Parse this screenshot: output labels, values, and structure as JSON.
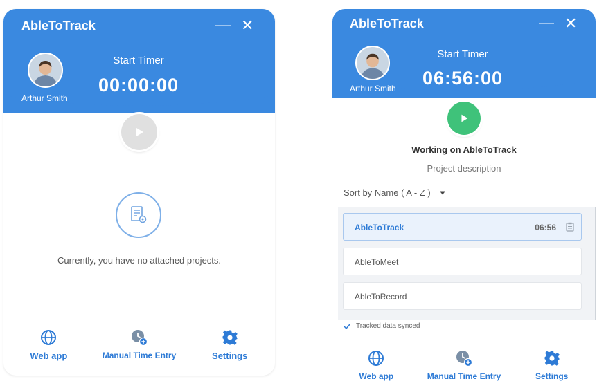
{
  "left": {
    "app_title": "AbleToTrack",
    "user_name": "Arthur Smith",
    "timer_label": "Start Timer",
    "timer_value": "00:00:00",
    "empty_message": "Currently, you have no attached projects.",
    "nav": [
      {
        "label": "Web app",
        "icon": "globe-icon"
      },
      {
        "label": "Manual Time Entry",
        "icon": "clock-plus-icon"
      },
      {
        "label": "Settings",
        "icon": "gear-icon"
      }
    ]
  },
  "right": {
    "app_title": "AbleToTrack",
    "user_name": "Arthur Smith",
    "timer_label": "Start Timer",
    "timer_value": "06:56:00",
    "working_title": "Working on AbleToTrack",
    "project_description": "Project description",
    "sort_label": "Sort by Name ( A - Z )",
    "projects": [
      {
        "name": "AbleToTrack",
        "time": "06:56",
        "active": true
      },
      {
        "name": "AbleToMeet",
        "time": "",
        "active": false
      },
      {
        "name": "AbleToRecord",
        "time": "",
        "active": false
      }
    ],
    "sync_status": "Tracked data synced",
    "nav": [
      {
        "label": "Web app",
        "icon": "globe-icon"
      },
      {
        "label": "Manual Time Entry",
        "icon": "clock-plus-icon"
      },
      {
        "label": "Settings",
        "icon": "gear-icon"
      }
    ]
  },
  "colors": {
    "header_blue": "#3a89e0",
    "accent_blue": "#2e7bd6",
    "play_idle": "#d9d9d9",
    "play_active": "#3fc27a"
  }
}
